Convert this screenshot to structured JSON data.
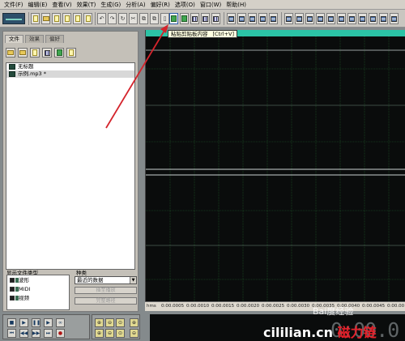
{
  "menu": [
    "文件(F)",
    "编辑(E)",
    "查看(V)",
    "效果(T)",
    "生成(G)",
    "分析(A)",
    "偏好(R)",
    "选项(O)",
    "窗口(W)",
    "帮助(H)"
  ],
  "tooltip": {
    "text": "粘贴剪贴板内容",
    "shortcut": "[Ctrl+V]"
  },
  "left_panel": {
    "tabs": [
      "文件",
      "效果",
      "偏好"
    ],
    "files": [
      "无标题",
      "示例.mp3 *"
    ],
    "types_label": "显示文件类型",
    "types": [
      "波形",
      "MIDI",
      "视频"
    ],
    "sort_label": "种类",
    "sort_value": "最近的数据",
    "btn_insert": "插至播放",
    "btn_full": "完整路径"
  },
  "ruler": {
    "unit": "hms",
    "ticks": [
      "0:00.0005",
      "0:00.0010",
      "0:00.0015",
      "0:00.0020",
      "0:00.0025",
      "0:00.0030",
      "0:00.0035",
      "0:00.0040",
      "0:00.0045",
      "0:00.00"
    ]
  },
  "clock": "0:00.0",
  "watermark_baidu": "Bai度经验",
  "watermark_site": {
    "latin": "cililian.cn ",
    "cn": "磁力链"
  },
  "colors": {
    "waveform_grid": "#1e5a2a",
    "timeline": "#2bc3a6",
    "center_line": "#c9d2d2",
    "arrow": "#d4242c"
  }
}
